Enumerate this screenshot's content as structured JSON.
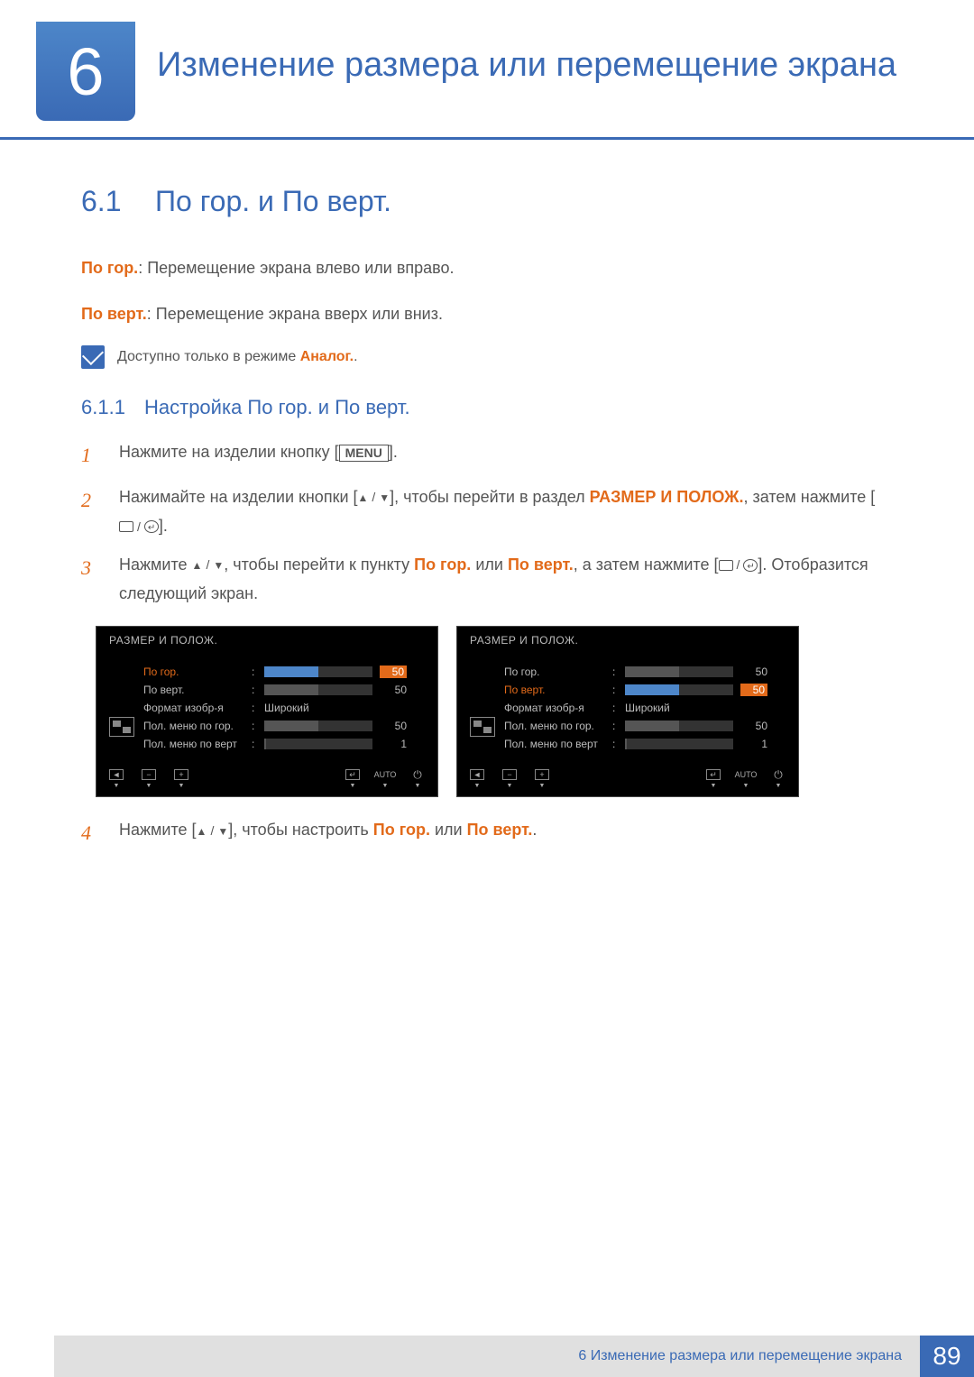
{
  "header": {
    "chapter_number": "6",
    "chapter_title": "Изменение размера или перемещение экрана"
  },
  "section": {
    "number": "6.1",
    "title": "По гор. и По верт."
  },
  "intro": {
    "line1_label": "По гор.",
    "line1_rest": ": Перемещение экрана влево или вправо.",
    "line2_label": "По верт.",
    "line2_rest": ": Перемещение экрана вверх или вниз."
  },
  "note": {
    "prefix": "Доступно только в режиме ",
    "mode": "Аналог.",
    "suffix": "."
  },
  "subsection": {
    "number": "6.1.1",
    "title": "Настройка По гор. и По верт."
  },
  "steps": {
    "s1_num": "1",
    "s1_a": "Нажмите на изделии кнопку [",
    "s1_menu": "MENU",
    "s1_b": "].",
    "s2_num": "2",
    "s2_a": "Нажимайте на изделии кнопки [",
    "s2_b": "], чтобы перейти в раздел ",
    "s2_size": "РАЗМЕР И ПОЛОЖ.",
    "s2_c": ", затем нажмите [",
    "s2_d": "].",
    "s3_num": "3",
    "s3_a": "Нажмите ",
    "s3_b": ", чтобы перейти к пункту ",
    "s3_hg": "По гор.",
    "s3_or": " или ",
    "s3_hv": "По верт.",
    "s3_c": ", а затем нажмите [",
    "s3_d": "]. Отобразится следующий экран.",
    "s4_num": "4",
    "s4_a": "Нажмите [",
    "s4_b": "], чтобы настроить ",
    "s4_hg": "По гор.",
    "s4_or": " или ",
    "s4_hv": "По верт.",
    "s4_c": "."
  },
  "osd": {
    "title": "РАЗМЕР И ПОЛОЖ.",
    "rows": [
      {
        "label": "По гор.",
        "value": "50",
        "bar": 50
      },
      {
        "label": "По верт.",
        "value": "50",
        "bar": 50
      },
      {
        "label": "Формат изобр-я",
        "text": "Широкий"
      },
      {
        "label": "Пол. меню по гор.",
        "value": "50",
        "bar": 50
      },
      {
        "label": "Пол. меню по верт",
        "value": "1",
        "bar": 2
      }
    ],
    "toolbar_auto": "AUTO"
  },
  "footer": {
    "text": "6 Изменение размера или перемещение экрана",
    "page": "89"
  }
}
